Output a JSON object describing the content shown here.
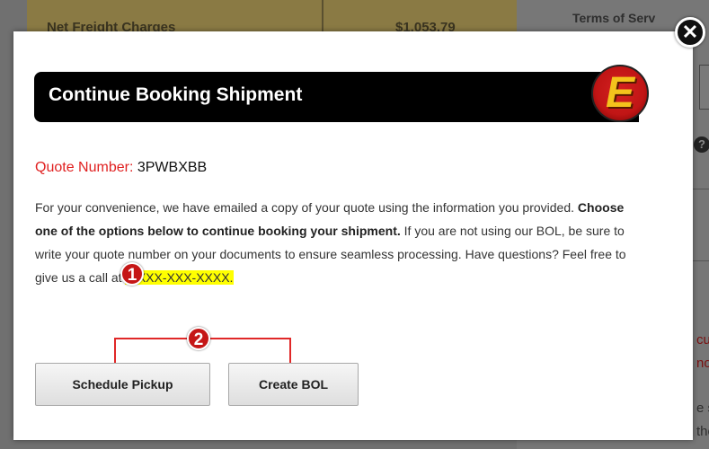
{
  "background": {
    "table_label": "Net Freight Charges",
    "table_value": "$1,053.79",
    "terms_link": "Terms of Serv",
    "side_red_1": "cu",
    "side_red_2": "nor",
    "side_text_1": "e s",
    "side_text_2": "the"
  },
  "modal": {
    "close_icon": "close-icon",
    "title": "Continue Booking Shipment",
    "logo_letter": "E",
    "quote_label": "Quote Number:",
    "quote_number": "3PWBXBB",
    "body_part1": "For your convenience, we have emailed a copy of your quote using the information you provided. ",
    "body_bold": "Choose one of the options below to continue booking your shipment.",
    "body_part2": " If you are not using our BOL, be sure to write your quote number on your documents to ensure seamless processing. Have questions? Feel free to give us a call at ",
    "phone": "1-XXX-XXX-XXXX.",
    "schedule_pickup_label": "Schedule Pickup",
    "create_bol_label": "Create BOL"
  },
  "annotations": {
    "marker_1": "1",
    "marker_2": "2"
  },
  "colors": {
    "quote_label": "#e02020",
    "marker": "#c51616",
    "highlight": "#ffff00",
    "title_bar": "#000000"
  }
}
